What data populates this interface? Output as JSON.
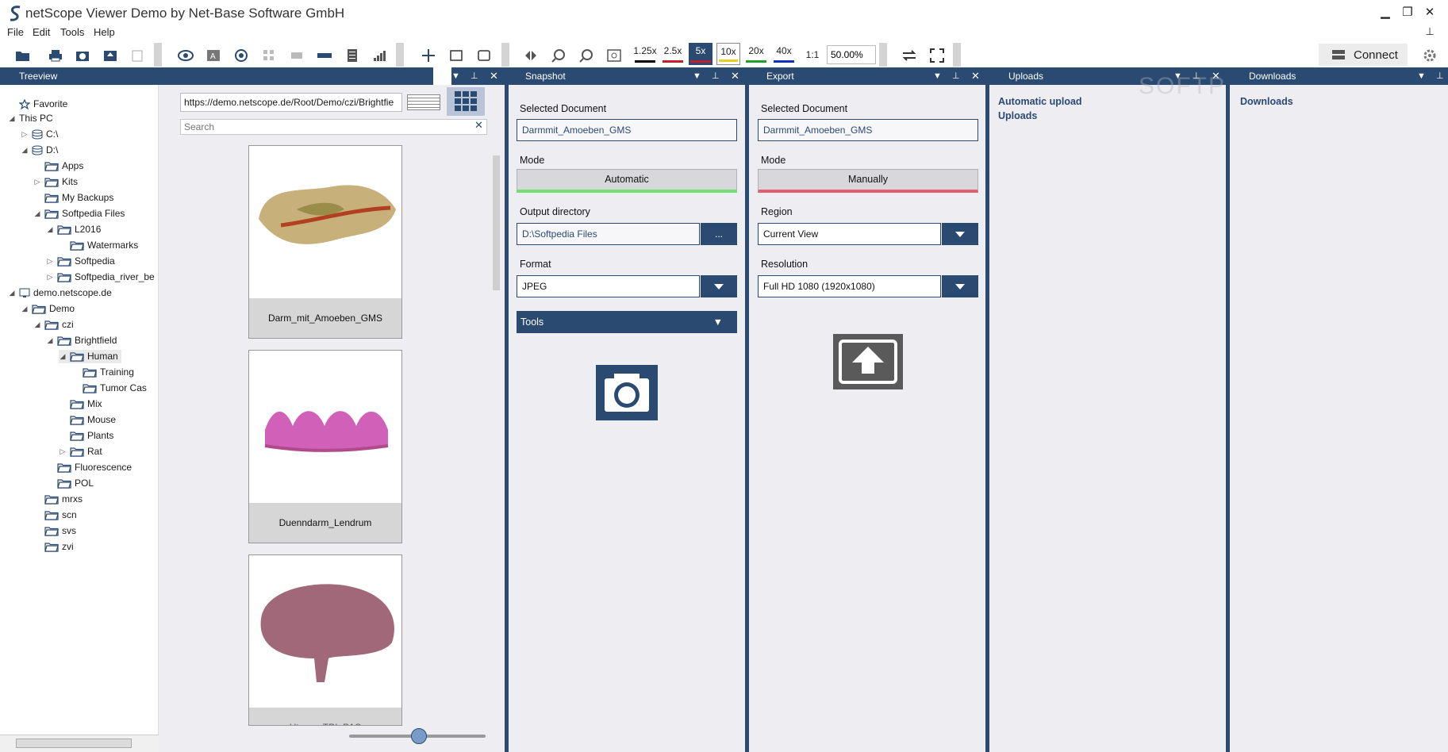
{
  "window": {
    "title": "netScope Viewer Demo by Net-Base Software GmbH"
  },
  "menu": [
    "File",
    "Edit",
    "Tools",
    "Help"
  ],
  "toolbar": {
    "magnifications": [
      "1.25x",
      "2.5x",
      "5x",
      "10x",
      "20x",
      "40x"
    ],
    "mag_colors": [
      "#000000",
      "#c0202a",
      "#c0202a",
      "#e8d020",
      "#20a030",
      "#1030c0"
    ],
    "one_to_one": "1:1",
    "zoom_value": "50.00%",
    "connect_label": "Connect"
  },
  "treeview": {
    "title": "Treeview",
    "items": [
      {
        "label": "Favorite",
        "icon": "star-icon",
        "depth": 0,
        "exp": ""
      },
      {
        "label": "This PC",
        "icon": "",
        "depth": 0,
        "exp": "◢"
      },
      {
        "label": "C:\\",
        "icon": "drive-icon",
        "depth": 1,
        "exp": "▷"
      },
      {
        "label": "D:\\",
        "icon": "drive-icon",
        "depth": 1,
        "exp": "◢"
      },
      {
        "label": "Apps",
        "icon": "folder-icon",
        "depth": 2,
        "exp": ""
      },
      {
        "label": "Kits",
        "icon": "folder-icon",
        "depth": 2,
        "exp": "▷"
      },
      {
        "label": "My Backups",
        "icon": "folder-icon",
        "depth": 2,
        "exp": ""
      },
      {
        "label": "Softpedia Files",
        "icon": "folder-icon",
        "depth": 2,
        "exp": "◢"
      },
      {
        "label": "L2016",
        "icon": "folder-icon",
        "depth": 3,
        "exp": "◢"
      },
      {
        "label": "Watermarks",
        "icon": "folder-icon",
        "depth": 4,
        "exp": ""
      },
      {
        "label": "Softpedia",
        "icon": "folder-icon",
        "depth": 3,
        "exp": "▷"
      },
      {
        "label": "Softpedia_river_be",
        "icon": "folder-icon",
        "depth": 3,
        "exp": "▷"
      },
      {
        "label": "demo.netscope.de",
        "icon": "server-icon",
        "depth": 0,
        "exp": "◢"
      },
      {
        "label": "Demo",
        "icon": "folder-icon",
        "depth": 1,
        "exp": "◢"
      },
      {
        "label": "czi",
        "icon": "folder-icon",
        "depth": 2,
        "exp": "◢"
      },
      {
        "label": "Brightfield",
        "icon": "folder-icon",
        "depth": 3,
        "exp": "◢"
      },
      {
        "label": "Human",
        "icon": "folder-icon",
        "depth": 4,
        "exp": "◢"
      },
      {
        "label": "Training",
        "icon": "folder-icon",
        "depth": 5,
        "exp": ""
      },
      {
        "label": "Tumor Cas",
        "icon": "folder-icon",
        "depth": 5,
        "exp": ""
      },
      {
        "label": "Mix",
        "icon": "folder-icon",
        "depth": 4,
        "exp": ""
      },
      {
        "label": "Mouse",
        "icon": "folder-icon",
        "depth": 4,
        "exp": ""
      },
      {
        "label": "Plants",
        "icon": "folder-icon",
        "depth": 4,
        "exp": ""
      },
      {
        "label": "Rat",
        "icon": "folder-icon",
        "depth": 4,
        "exp": "▷"
      },
      {
        "label": "Fluorescence",
        "icon": "folder-icon",
        "depth": 3,
        "exp": ""
      },
      {
        "label": "POL",
        "icon": "folder-icon",
        "depth": 3,
        "exp": ""
      },
      {
        "label": "mrxs",
        "icon": "folder-icon",
        "depth": 2,
        "exp": ""
      },
      {
        "label": "scn",
        "icon": "folder-icon",
        "depth": 2,
        "exp": ""
      },
      {
        "label": "svs",
        "icon": "folder-icon",
        "depth": 2,
        "exp": ""
      },
      {
        "label": "zvi",
        "icon": "folder-icon",
        "depth": 2,
        "exp": ""
      }
    ]
  },
  "browser": {
    "url": "https://demo.netscope.de/Root/Demo/czi/Brightfie",
    "search_placeholder": "Search",
    "thumbnails": [
      "Darm_mit_Amoeben_GMS",
      "Duenndarm_Lendrum",
      "Uterus_TPI_PAS"
    ]
  },
  "snapshot": {
    "title": "Snapshot",
    "selected_label": "Selected Document",
    "selected_value": "Darmmit_Amoeben_GMS",
    "mode_label": "Mode",
    "mode_value": "Automatic",
    "output_label": "Output directory",
    "output_value": "D:\\Softpedia Files",
    "browse_label": "...",
    "format_label": "Format",
    "format_value": "JPEG",
    "tools_label": "Tools"
  },
  "export": {
    "title": "Export",
    "selected_label": "Selected Document",
    "selected_value": "Darmmit_Amoeben_GMS",
    "mode_label": "Mode",
    "mode_value": "Manually",
    "region_label": "Region",
    "region_value": "Current View",
    "resolution_label": "Resolution",
    "resolution_value": "Full HD 1080 (1920x1080)"
  },
  "uploads": {
    "title": "Uploads",
    "items": [
      "Automatic upload",
      "Uploads"
    ]
  },
  "downloads": {
    "title": "Downloads",
    "items": [
      "Downloads"
    ]
  },
  "watermark": "SOFTPEDIA"
}
